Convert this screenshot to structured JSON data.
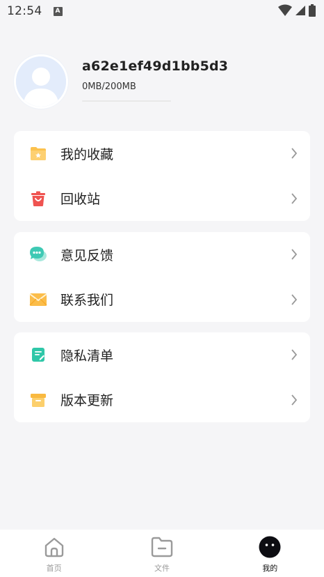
{
  "status_bar": {
    "time": "12:54",
    "notification_icon": "A"
  },
  "profile": {
    "username": "a62e1ef49d1bb5d3",
    "storage": "0MB/200MB",
    "storage_used_fraction": 0
  },
  "menu_groups": [
    {
      "items": [
        {
          "label": "我的收藏",
          "icon": "folder-star-icon"
        },
        {
          "label": "回收站",
          "icon": "trash-basket-icon"
        }
      ]
    },
    {
      "items": [
        {
          "label": "意见反馈",
          "icon": "chat-bubble-icon"
        },
        {
          "label": "联系我们",
          "icon": "envelope-icon"
        }
      ]
    },
    {
      "items": [
        {
          "label": "隐私清单",
          "icon": "note-edit-icon"
        },
        {
          "label": "版本更新",
          "icon": "box-icon"
        }
      ]
    }
  ],
  "bottom_nav": {
    "tabs": [
      {
        "label": "首页",
        "icon": "home-icon",
        "active": false
      },
      {
        "label": "文件",
        "icon": "folder-icon",
        "active": false
      },
      {
        "label": "我的",
        "icon": "profile-face-icon",
        "active": true
      }
    ]
  },
  "colors": {
    "background": "#f5f5f7",
    "card": "#ffffff",
    "folder_yellow": "#fcc24e",
    "trash_red": "#ef5350",
    "chat_teal": "#3ec9b4",
    "envelope_yellow": "#fbbd4a",
    "note_teal": "#2fc7a8",
    "box_yellow": "#f9b940"
  }
}
